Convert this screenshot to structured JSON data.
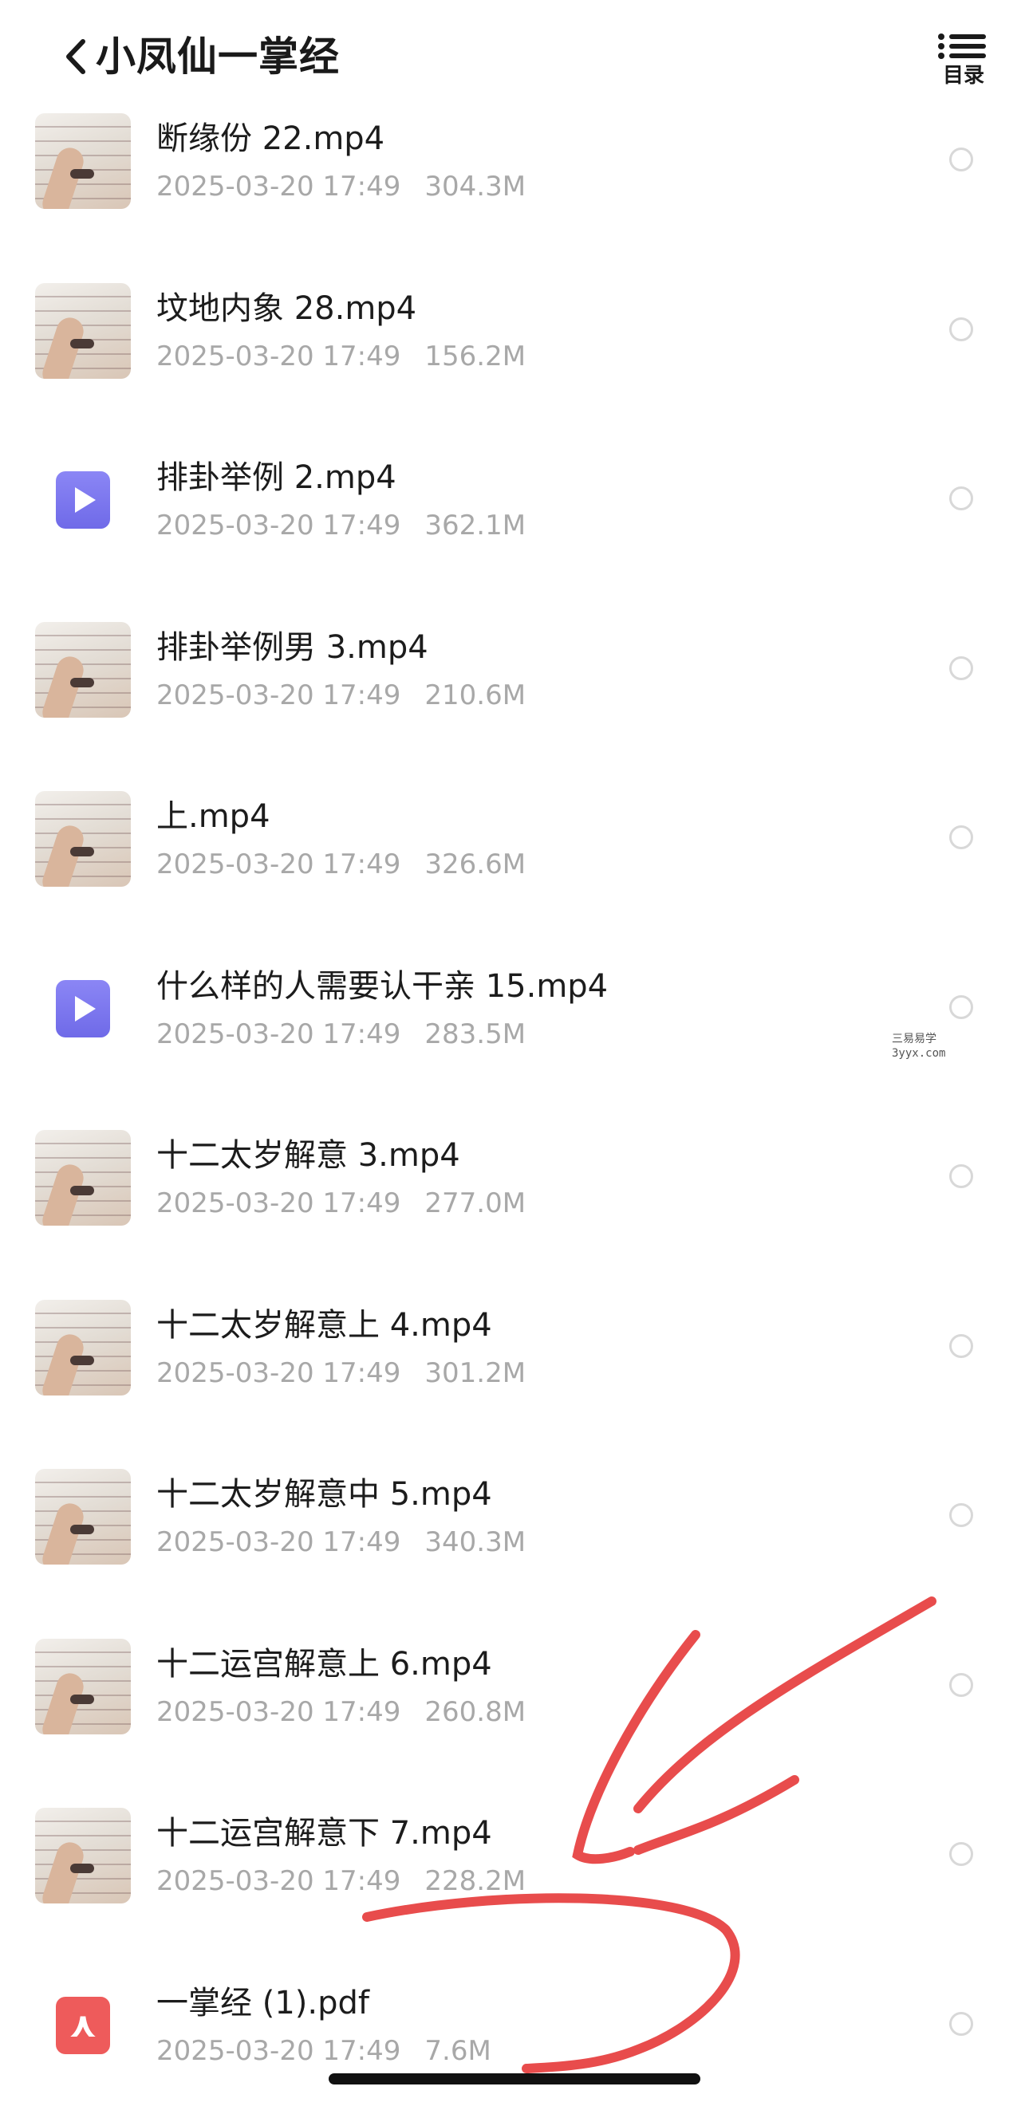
{
  "header": {
    "title": "小凤仙一掌经",
    "toc_label": "目录",
    "back_icon": "chevron-left-icon",
    "toc_icon": "list-icon"
  },
  "files": [
    {
      "name": "断缘份 22.mp4",
      "date": "2025-03-20 17:49",
      "size": "304.3M",
      "thumb": "photo"
    },
    {
      "name": "坟地内象 28.mp4",
      "date": "2025-03-20 17:49",
      "size": "156.2M",
      "thumb": "photo"
    },
    {
      "name": "排卦举例 2.mp4",
      "date": "2025-03-20 17:49",
      "size": "362.1M",
      "thumb": "video-icon"
    },
    {
      "name": "排卦举例男 3.mp4",
      "date": "2025-03-20 17:49",
      "size": "210.6M",
      "thumb": "photo"
    },
    {
      "name": "上.mp4",
      "date": "2025-03-20 17:49",
      "size": "326.6M",
      "thumb": "photo"
    },
    {
      "name": "什么样的人需要认干亲 15.mp4",
      "date": "2025-03-20 17:49",
      "size": "283.5M",
      "thumb": "video-icon"
    },
    {
      "name": "十二太岁解意 3.mp4",
      "date": "2025-03-20 17:49",
      "size": "277.0M",
      "thumb": "photo"
    },
    {
      "name": "十二太岁解意上 4.mp4",
      "date": "2025-03-20 17:49",
      "size": "301.2M",
      "thumb": "photo"
    },
    {
      "name": "十二太岁解意中 5.mp4",
      "date": "2025-03-20 17:49",
      "size": "340.3M",
      "thumb": "photo"
    },
    {
      "name": "十二运宫解意上 6.mp4",
      "date": "2025-03-20 17:49",
      "size": "260.8M",
      "thumb": "photo"
    },
    {
      "name": "十二运宫解意下 7.mp4",
      "date": "2025-03-20 17:49",
      "size": "228.2M",
      "thumb": "photo"
    },
    {
      "name": "一掌经 (1).pdf",
      "date": "2025-03-20 17:49",
      "size": "7.6M",
      "thumb": "pdf-icon"
    }
  ],
  "watermark": {
    "line1": "三易易学",
    "line2": "3yyx.com"
  },
  "colors": {
    "accent_annotation": "#e84c4c",
    "video_icon": "#7a75ee",
    "pdf_icon": "#ee5b5b",
    "meta_text": "#a8a8a8"
  }
}
